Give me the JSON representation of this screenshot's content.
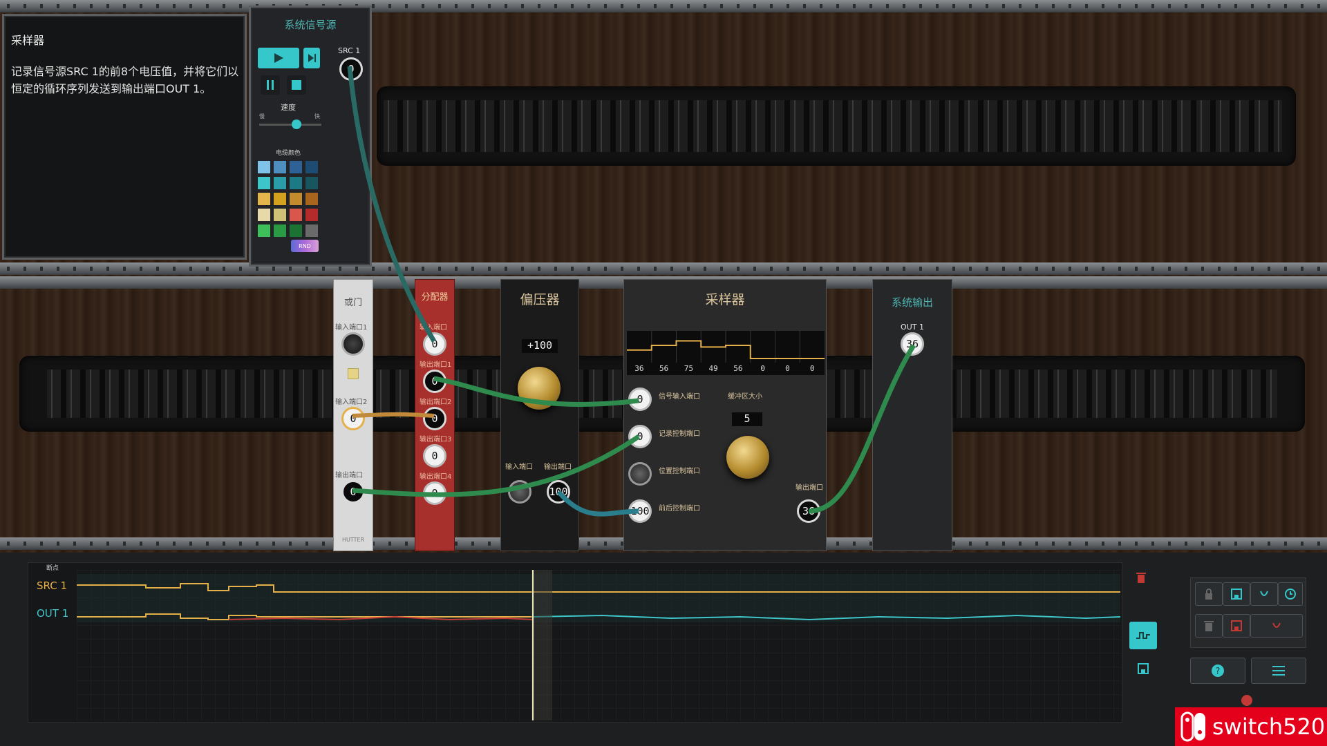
{
  "task": {
    "title": "采样器",
    "description": "记录信号源SRC 1的前8个电压值，并将它们以恒定的循环序列发送到输出端口OUT 1。"
  },
  "source_panel": {
    "title": "系统信号源",
    "port_label": "SRC 1",
    "port_value": "0",
    "speed_label": "速度",
    "speed_min": "慢",
    "speed_max": "快",
    "speed_level": 0.6,
    "colors_label": "电缆颜色",
    "rnd_label": "RND",
    "swatches": [
      "#7fc4e8",
      "#4e8fc0",
      "#2e6296",
      "#1e4b72",
      "#3cc6c9",
      "#2a9da8",
      "#1c7a86",
      "#17565f",
      "#e3b54a",
      "#d4a21f",
      "#c48b2c",
      "#a8651e",
      "#e7d9a8",
      "#cfc178",
      "#d9564a",
      "#b32b2b",
      "#3fbf5a",
      "#2a9a44",
      "#1b7233",
      "#6a6a6a"
    ]
  },
  "or_gate": {
    "title": "或门",
    "in1_label": "输入端口1",
    "in2_label": "输入端口2",
    "in2_value": "0",
    "out_label": "输出端口",
    "out_value": "0",
    "footer": "HUTTER"
  },
  "distributor": {
    "title": "分配器",
    "in_label": "输入端口",
    "in_value": "0",
    "outputs": [
      {
        "label": "输出端口1",
        "value": "0"
      },
      {
        "label": "输出端口2",
        "value": "0"
      },
      {
        "label": "输出端口3",
        "value": "0"
      },
      {
        "label": "输出端口4",
        "value": "0"
      }
    ]
  },
  "biaser": {
    "title": "偏压器",
    "value": "+100",
    "in_label": "输入端口",
    "out_label": "输出端口",
    "out_value": "100"
  },
  "sampler": {
    "title": "采样器",
    "buffer": [
      "36",
      "56",
      "75",
      "49",
      "56",
      "0",
      "0",
      "0"
    ],
    "signal_in_label": "信号输入端口",
    "signal_in_value": "0",
    "record_label": "记录控制端口",
    "record_value": "0",
    "position_label": "位置控制端口",
    "direction_label": "前后控制端口",
    "direction_value": "100",
    "buffer_size_label": "缓冲区大小",
    "buffer_size_value": "5",
    "out_label": "输出端口",
    "out_value": "36"
  },
  "system_output": {
    "title": "系统输出",
    "port_label": "OUT 1",
    "port_value": "36"
  },
  "timeline": {
    "breakpoint_label": "断点",
    "tracks": [
      {
        "name": "SRC 1",
        "color": "#e4b04a"
      },
      {
        "name": "OUT 1",
        "color": "#3fc6c9"
      }
    ]
  },
  "watermark": "switch520",
  "colors": {
    "accent": "#35c7c9",
    "red": "#c23a36",
    "gold": "#d8c39a"
  }
}
